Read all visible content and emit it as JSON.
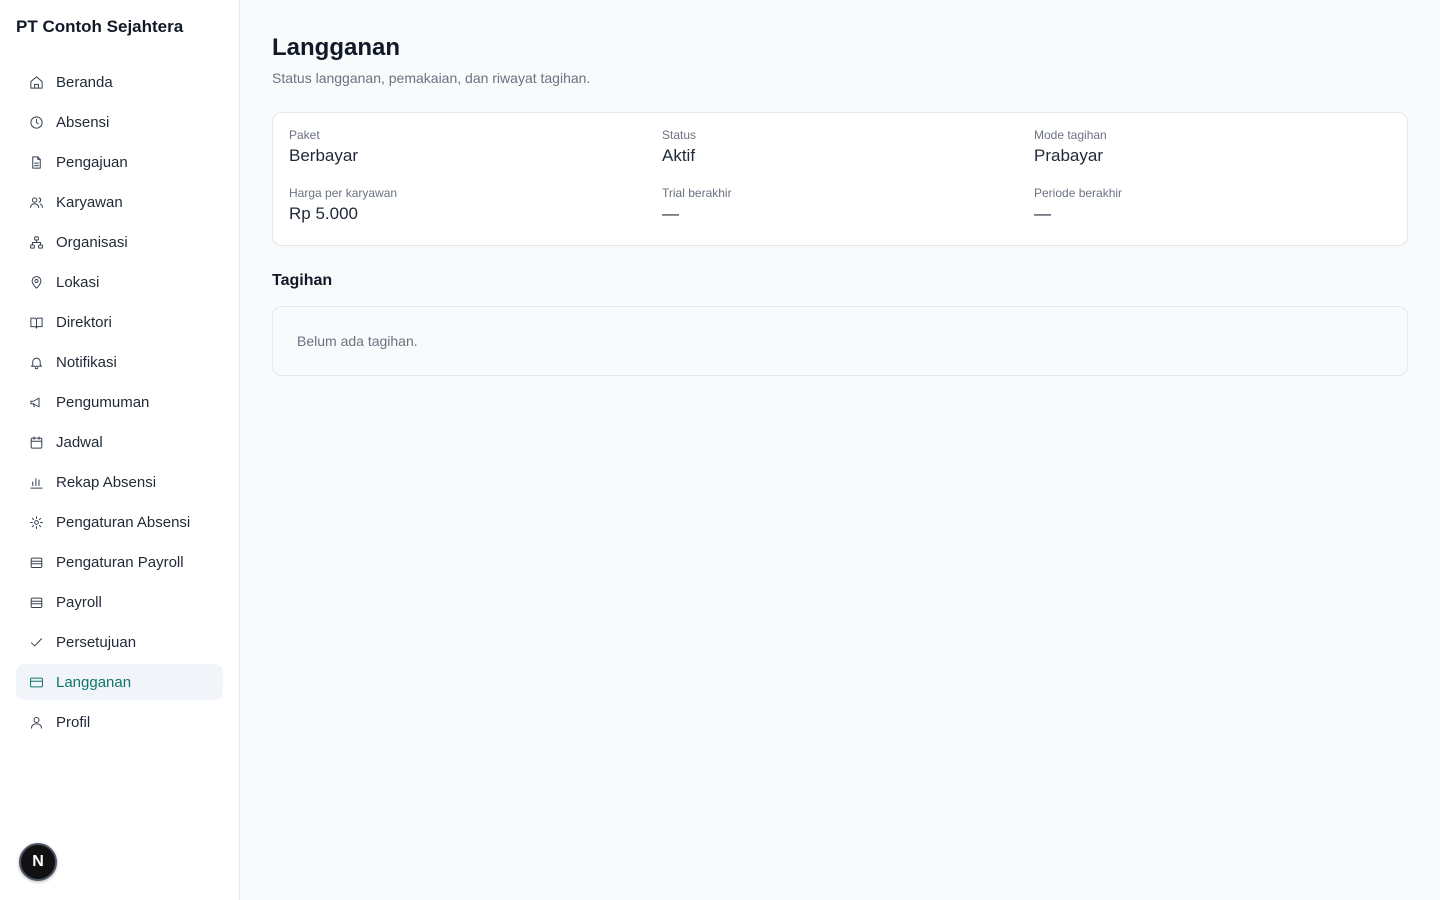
{
  "company_name": "PT Contoh Sejahtera",
  "nav": [
    {
      "label": "Beranda",
      "icon": "home-icon"
    },
    {
      "label": "Absensi",
      "icon": "clock-icon"
    },
    {
      "label": "Pengajuan",
      "icon": "file-icon"
    },
    {
      "label": "Karyawan",
      "icon": "users-icon"
    },
    {
      "label": "Organisasi",
      "icon": "sitemap-icon"
    },
    {
      "label": "Lokasi",
      "icon": "map-pin-icon"
    },
    {
      "label": "Direktori",
      "icon": "book-open-icon"
    },
    {
      "label": "Notifikasi",
      "icon": "bell-icon"
    },
    {
      "label": "Pengumuman",
      "icon": "megaphone-icon"
    },
    {
      "label": "Jadwal",
      "icon": "calendar-icon"
    },
    {
      "label": "Rekap Absensi",
      "icon": "bar-chart-icon"
    },
    {
      "label": "Pengaturan Absensi",
      "icon": "gear-icon"
    },
    {
      "label": "Pengaturan Payroll",
      "icon": "wallet-icon"
    },
    {
      "label": "Payroll",
      "icon": "wallet-icon"
    },
    {
      "label": "Persetujuan",
      "icon": "check-icon"
    },
    {
      "label": "Langganan",
      "icon": "credit-card-icon",
      "active": true
    },
    {
      "label": "Profil",
      "icon": "user-icon"
    }
  ],
  "badge_letter": "N",
  "page": {
    "title": "Langganan",
    "subtitle": "Status langganan, pemakaian, dan riwayat tagihan."
  },
  "subscription": {
    "paket_label": "Paket",
    "paket_value": "Berbayar",
    "status_label": "Status",
    "status_value": "Aktif",
    "mode_label": "Mode tagihan",
    "mode_value": "Prabayar",
    "harga_label": "Harga per karyawan",
    "harga_value": "Rp 5.000",
    "trial_label": "Trial berakhir",
    "trial_value": "—",
    "periode_label": "Periode berakhir",
    "periode_value": "—"
  },
  "invoices": {
    "title": "Tagihan",
    "empty_text": "Belum ada tagihan."
  },
  "colors": {
    "accent": "#0f766e",
    "active_bg": "#f1f5f9",
    "page_bg": "#f8fafc"
  }
}
